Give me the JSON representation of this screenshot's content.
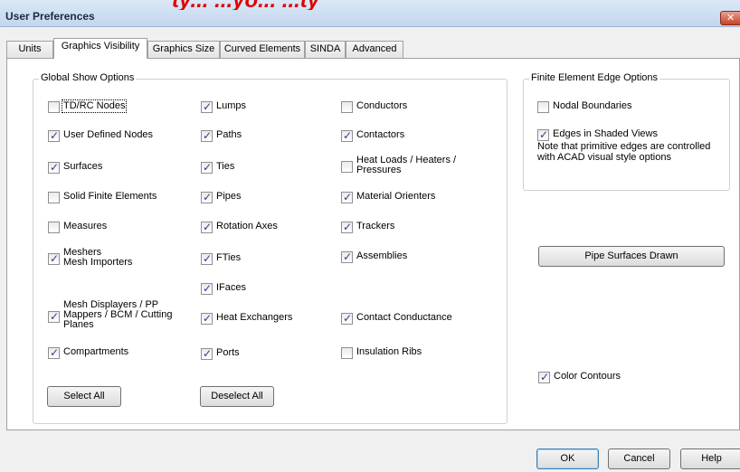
{
  "window": {
    "title": "User Preferences",
    "close_glyph": "✕",
    "overlay_text": "ty... ...yo... ...ty"
  },
  "tabs": [
    {
      "label": "Units"
    },
    {
      "label": "Graphics Visibility",
      "active": true
    },
    {
      "label": "Graphics Size"
    },
    {
      "label": "Curved Elements"
    },
    {
      "label": "SINDA"
    },
    {
      "label": "Advanced"
    }
  ],
  "global_show": {
    "title": "Global Show Options",
    "col1": [
      {
        "label": "TD/RC Nodes",
        "checked": false
      },
      {
        "label": "User Defined Nodes",
        "checked": true
      },
      {
        "label": "Surfaces",
        "checked": true
      },
      {
        "label": "Solid Finite Elements",
        "checked": false
      },
      {
        "label": "Measures",
        "checked": false
      },
      {
        "label": "Meshers\nMesh Importers",
        "checked": true
      },
      {
        "label": "Mesh Displayers / PP\nMappers / BCM / Cutting\nPlanes",
        "checked": true
      },
      {
        "label": "Compartments",
        "checked": true
      }
    ],
    "col2": [
      {
        "label": "Lumps",
        "checked": true
      },
      {
        "label": "Paths",
        "checked": true
      },
      {
        "label": "Ties",
        "checked": true
      },
      {
        "label": "Pipes",
        "checked": true
      },
      {
        "label": "Rotation Axes",
        "checked": true
      },
      {
        "label": "FTies",
        "checked": true
      },
      {
        "label": "IFaces",
        "checked": true
      },
      {
        "label": "Heat Exchangers",
        "checked": true
      },
      {
        "label": "Ports",
        "checked": true
      }
    ],
    "col3": [
      {
        "label": "Conductors",
        "checked": false
      },
      {
        "label": "Contactors",
        "checked": true
      },
      {
        "label": "Heat Loads / Heaters /\nPressures",
        "checked": false
      },
      {
        "label": "Material Orienters",
        "checked": true
      },
      {
        "label": "Trackers",
        "checked": true
      },
      {
        "label": "Assemblies",
        "checked": true
      },
      {
        "label": "Contact Conductance",
        "checked": true
      },
      {
        "label": "Insulation Ribs",
        "checked": false
      }
    ],
    "select_all_label": "Select All",
    "deselect_all_label": "Deselect All"
  },
  "fe_edge": {
    "title": "Finite Element Edge Options",
    "nodal_boundaries": {
      "label": "Nodal Boundaries",
      "checked": false
    },
    "edges_shaded": {
      "label": "Edges in Shaded Views",
      "checked": true
    },
    "note": "Note that primitive edges are controlled\nwith ACAD visual style options"
  },
  "pipe_surfaces_label": "Pipe Surfaces Drawn",
  "color_contours": {
    "label": "Color Contours",
    "checked": true
  },
  "footer": {
    "ok_label": "OK",
    "cancel_label": "Cancel",
    "help_label": "Help"
  }
}
